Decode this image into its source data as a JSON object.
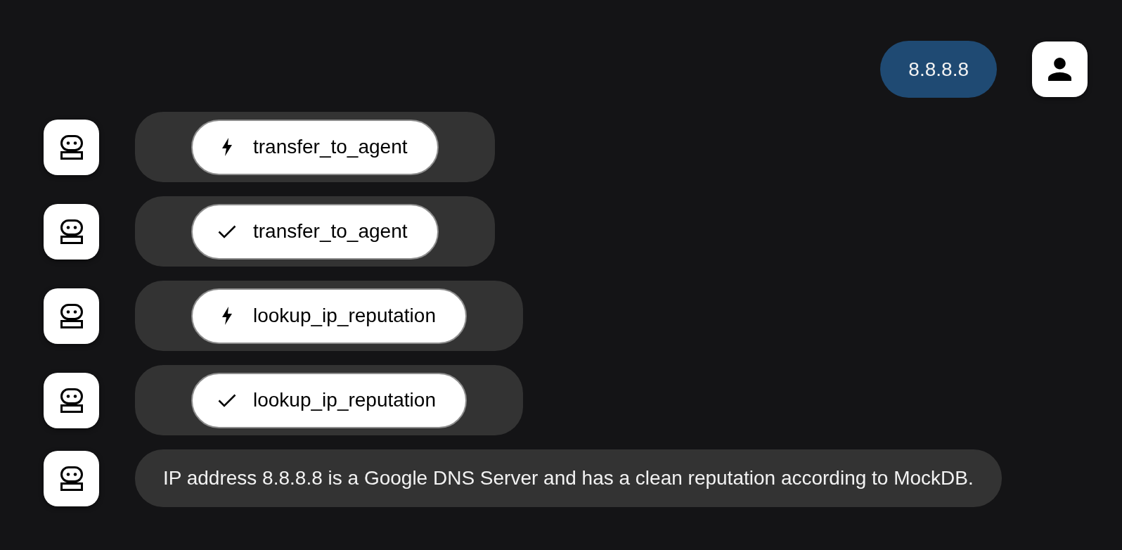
{
  "messages": [
    {
      "kind": "user_text",
      "text": "8.8.8.8"
    },
    {
      "kind": "tool_call",
      "tool": "transfer_to_agent"
    },
    {
      "kind": "tool_result",
      "tool": "transfer_to_agent"
    },
    {
      "kind": "tool_call",
      "tool": "lookup_ip_reputation"
    },
    {
      "kind": "tool_result",
      "tool": "lookup_ip_reputation"
    },
    {
      "kind": "agent_text",
      "text": "IP address 8.8.8.8 is a Google DNS Server and has a clean reputation according to MockDB."
    }
  ]
}
